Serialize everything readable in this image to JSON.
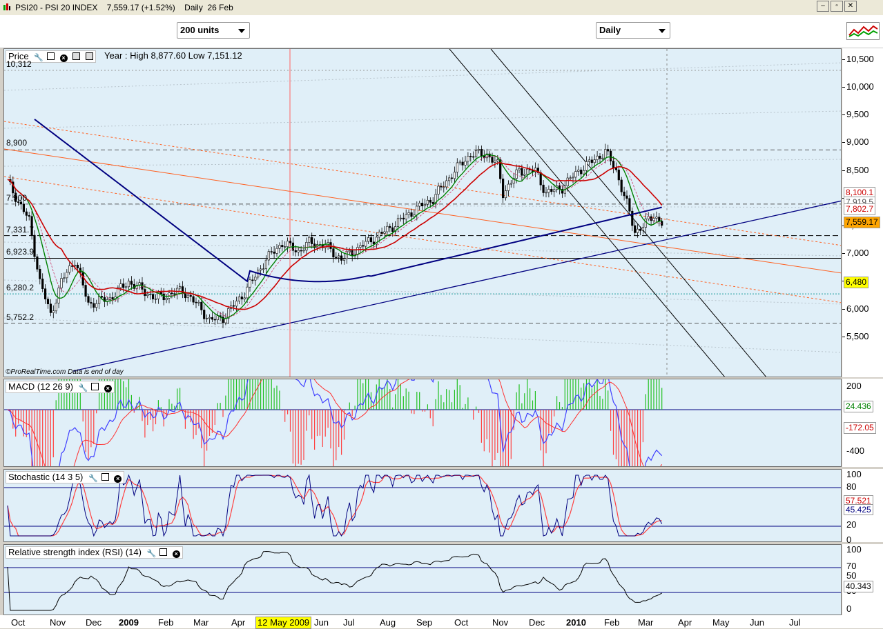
{
  "window": {
    "title": "PSI20 - PSI 20 INDEX",
    "price": "7,559.17 (+1.52%)",
    "interval": "Daily",
    "date": "26 Feb"
  },
  "toolbar": {
    "units": "200 units",
    "period": "Daily"
  },
  "price_pane": {
    "label": "Price",
    "year_info": "Year : High 8,877.60 Low 7,151.12",
    "left_levels": [
      "10,312",
      "8,900",
      "7,900",
      "7,331.7",
      "6,923.9",
      "6,280.2",
      "5,752.2"
    ],
    "axis_ticks": [
      "10,500",
      "10,000",
      "9,500",
      "9,000",
      "8,500",
      "8,000",
      "7,500",
      "7,000",
      "6,500",
      "6,000",
      "5,500"
    ],
    "flags": [
      {
        "text": "8,100.1",
        "color": "#cc0000"
      },
      {
        "text": "7,919.5",
        "color": "#555555"
      },
      {
        "text": "7,802.7",
        "color": "#cc0000"
      },
      {
        "text": "7,559.17",
        "color": "#000000",
        "bg": "#ffa500"
      },
      {
        "text": "6,480",
        "color": "#000000",
        "bg": "#ffff00"
      }
    ],
    "watermark": "©ProRealTime.com  Data is end of day"
  },
  "macd_pane": {
    "label": "MACD (12 26 9)",
    "axis_ticks": [
      "200",
      "0",
      "-200",
      "-400"
    ],
    "flags": [
      {
        "text": "24.436",
        "color": "#008000"
      },
      {
        "text": "-172.05",
        "color": "#cc0000"
      }
    ]
  },
  "stoch_pane": {
    "label": "Stochastic (14 3 5)",
    "axis_ticks": [
      "100",
      "80",
      "20",
      "0"
    ],
    "flags": [
      {
        "text": "57.521",
        "color": "#cc0000"
      },
      {
        "text": "45.425",
        "color": "#000080"
      }
    ]
  },
  "rsi_pane": {
    "label": "Relative strength index (RSI) (14)",
    "axis_ticks": [
      "100",
      "70",
      "50",
      "30",
      "0"
    ],
    "flags": [
      {
        "text": "40.343",
        "color": "#000000"
      }
    ]
  },
  "x_axis": {
    "labels": [
      "Oct",
      "Nov",
      "Dec",
      "2009",
      "Feb",
      "Mar",
      "Apr",
      "May",
      "Jun",
      "Jul",
      "Aug",
      "Sep",
      "Oct",
      "Nov",
      "Dec",
      "2010",
      "Feb",
      "Mar",
      "Apr",
      "May",
      "Jun",
      "Jul"
    ],
    "cursor_date": "12 May 2009"
  },
  "colors": {
    "pane_bg": "#e0eff8",
    "ma_red": "#cc0000",
    "ma_green": "#008000",
    "ma_blue": "#000080",
    "up": "#00a000",
    "down": "#000000"
  }
}
